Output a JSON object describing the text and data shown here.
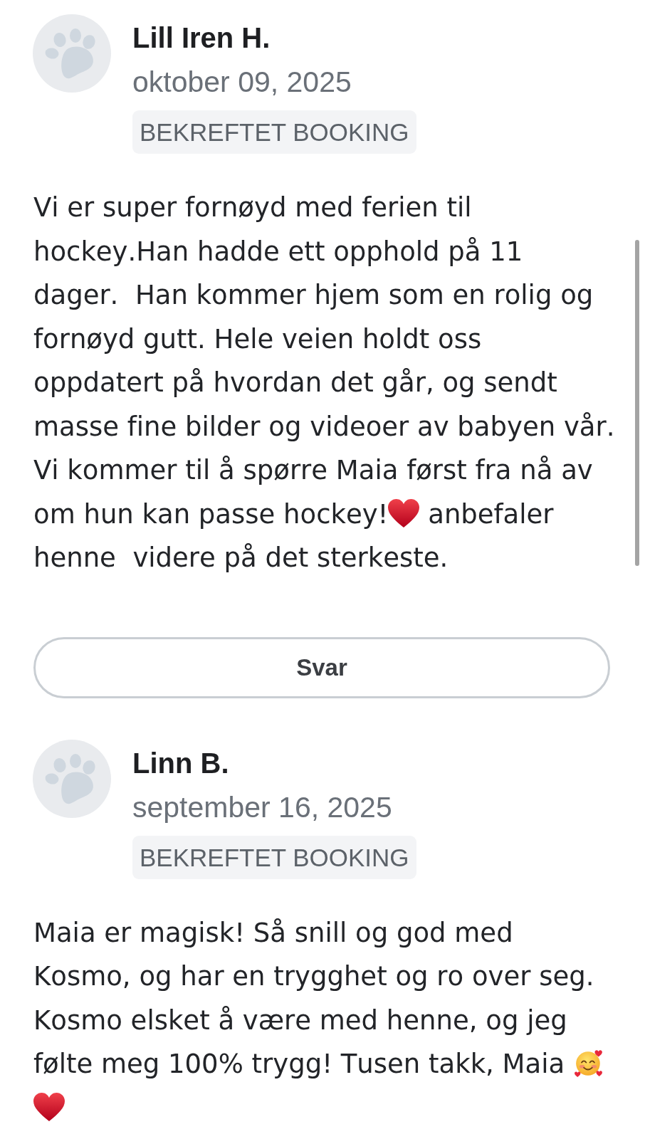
{
  "reviews": [
    {
      "name": "Lill Iren H.",
      "date": "oktober 09, 2025",
      "badge": "BEKREFTET BOOKING",
      "body": [
        {
          "kind": "text",
          "text": "Vi er super fornøyd med ferien til hockey.Han hadde ett opphold på 11 dager.  Han kommer hjem som en rolig og fornøyd gutt. Hele veien holdt oss oppdatert på hvordan det går, og sendt masse fine bilder og videoer av babyen vår. Vi kommer til å spørre Maia først fra nå av om hun kan passe hockey!"
        },
        {
          "kind": "heart"
        },
        {
          "kind": "text",
          "text": " anbefaler henne  videre på det sterkeste."
        }
      ],
      "reply_button": "Svar"
    },
    {
      "name": "Linn B.",
      "date": "september 16, 2025",
      "badge": "BEKREFTET BOOKING",
      "body": [
        {
          "kind": "text",
          "text": "Maia er magisk! Så snill og god med Kosmo, og har en trygghet og ro over seg. Kosmo elsket å være med henne, og jeg følte meg 100% trygg! Tusen takk, Maia "
        },
        {
          "kind": "smiley"
        },
        {
          "kind": "heart"
        }
      ]
    }
  ]
}
